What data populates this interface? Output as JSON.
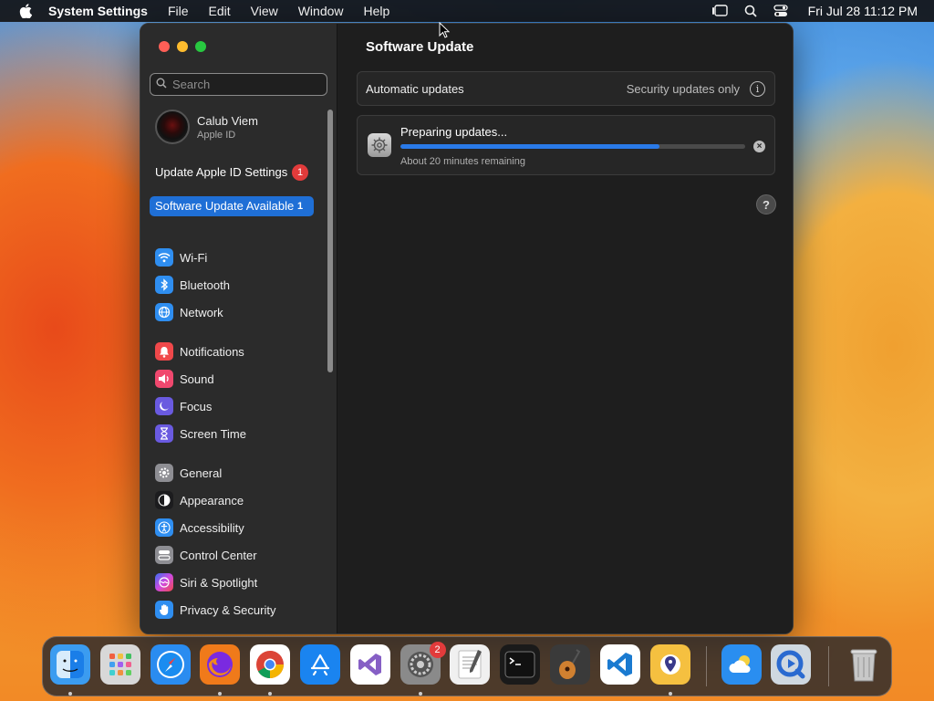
{
  "menubar": {
    "app_name": "System Settings",
    "menus": [
      "File",
      "Edit",
      "View",
      "Window",
      "Help"
    ],
    "clock": "Fri Jul 28  11:12 PM"
  },
  "sidebar": {
    "search_placeholder": "Search",
    "account": {
      "name": "Calub Viem",
      "subtitle": "Apple ID"
    },
    "alerts": [
      {
        "label": "Update Apple ID Settings",
        "badge": "1"
      },
      {
        "label": "Software Update Available",
        "badge": "1",
        "selected": true
      }
    ],
    "groups": [
      [
        {
          "label": "Wi-Fi",
          "icon": "wifi-icon",
          "color": "#2f8ef0"
        },
        {
          "label": "Bluetooth",
          "icon": "bluetooth-icon",
          "color": "#2f8ef0"
        },
        {
          "label": "Network",
          "icon": "globe-icon",
          "color": "#2f8ef0"
        }
      ],
      [
        {
          "label": "Notifications",
          "icon": "bell-icon",
          "color": "#f0484a"
        },
        {
          "label": "Sound",
          "icon": "speaker-icon",
          "color": "#f0486e"
        },
        {
          "label": "Focus",
          "icon": "moon-icon",
          "color": "#6a5ae0"
        },
        {
          "label": "Screen Time",
          "icon": "hourglass-icon",
          "color": "#6a5ae0"
        }
      ],
      [
        {
          "label": "General",
          "icon": "gear-icon",
          "color": "#8e8e93"
        },
        {
          "label": "Appearance",
          "icon": "appearance-icon",
          "color": "#1c1c1e"
        },
        {
          "label": "Accessibility",
          "icon": "accessibility-icon",
          "color": "#2f8ef0"
        },
        {
          "label": "Control Center",
          "icon": "control-center-icon",
          "color": "#8e8e93"
        },
        {
          "label": "Siri & Spotlight",
          "icon": "siri-icon",
          "color": "#b04ae0"
        },
        {
          "label": "Privacy & Security",
          "icon": "hand-icon",
          "color": "#2f8ef0"
        }
      ]
    ]
  },
  "main": {
    "title": "Software Update",
    "automatic": {
      "label": "Automatic updates",
      "value": "Security updates only"
    },
    "preparing": {
      "title": "Preparing updates...",
      "progress": 0.75,
      "remaining": "About 20 minutes remaining"
    },
    "help_label": "?"
  },
  "dock": {
    "apps": [
      {
        "name": "Finder",
        "color": "#3b9cf0",
        "running": true
      },
      {
        "name": "Launchpad",
        "color": "#d8d8d8",
        "running": false
      },
      {
        "name": "Safari",
        "color": "#2a8cf0",
        "running": false
      },
      {
        "name": "Firefox",
        "color": "#f07a1a",
        "running": true
      },
      {
        "name": "Chrome",
        "color": "#ffffff",
        "running": true
      },
      {
        "name": "App Store",
        "color": "#1a84f0",
        "running": false
      },
      {
        "name": "Visual Studio",
        "color": "#ffffff",
        "running": false
      },
      {
        "name": "System Settings",
        "color": "#8a8a8a",
        "running": true,
        "badge": "2"
      },
      {
        "name": "TextEdit",
        "color": "#f0f0f0",
        "running": false
      },
      {
        "name": "Terminal",
        "color": "#1a1a1a",
        "running": false
      },
      {
        "name": "GarageBand",
        "color": "#3a3a3a",
        "running": false
      },
      {
        "name": "VS Code",
        "color": "#ffffff",
        "running": false
      },
      {
        "name": "Bitwarden",
        "color": "#f5c040",
        "running": true
      }
    ],
    "extras": [
      {
        "name": "Weather",
        "color": "#2a8ef0"
      },
      {
        "name": "QuickTime",
        "color": "#cfd8e0"
      }
    ],
    "trash": {
      "name": "Trash"
    }
  }
}
